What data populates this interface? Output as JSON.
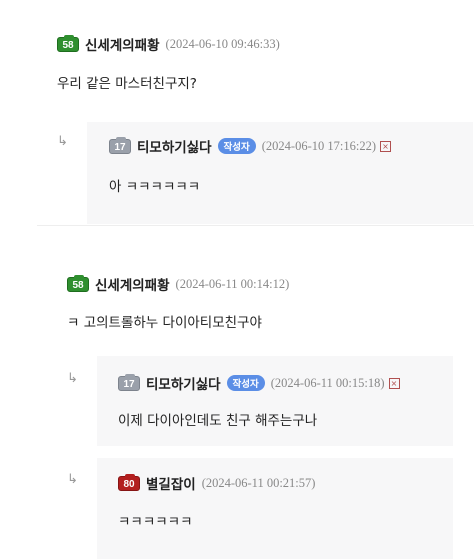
{
  "comments": [
    {
      "level": "58",
      "nickname": "신세계의패황",
      "date": "(2024-06-10 09:46:33)",
      "text": "우리 같은 마스터친구지?",
      "replies": [
        {
          "level": "17",
          "nickname": "티모하기싫다",
          "tag": "작성자",
          "date": "(2024-06-10 17:16:22)",
          "delete_mark": "×",
          "text": "아 ㅋㅋㅋㅋㅋㅋ"
        }
      ]
    },
    {
      "level": "58",
      "nickname": "신세계의패황",
      "date": "(2024-06-11 00:14:12)",
      "text": "ㅋ 고의트롤하누 다이아티모친구야",
      "replies": [
        {
          "level": "17",
          "nickname": "티모하기싫다",
          "tag": "작성자",
          "date": "(2024-06-11 00:15:18)",
          "delete_mark": "×",
          "text": "이제 다이아인데도 친구 해주는구나"
        },
        {
          "level": "80",
          "nickname": "별길잡이",
          "date": "(2024-06-11 00:21:57)",
          "text": "ㅋㅋㅋㅋㅋㅋ"
        }
      ]
    }
  ],
  "reply_arrow": "↳",
  "colors": {
    "level_58": "#2f8f2f",
    "level_17": "#9aa0aa",
    "level_80": "#b31f1f",
    "author_tag": "#5b8ee6",
    "reply_background": "#f7f7f8"
  }
}
